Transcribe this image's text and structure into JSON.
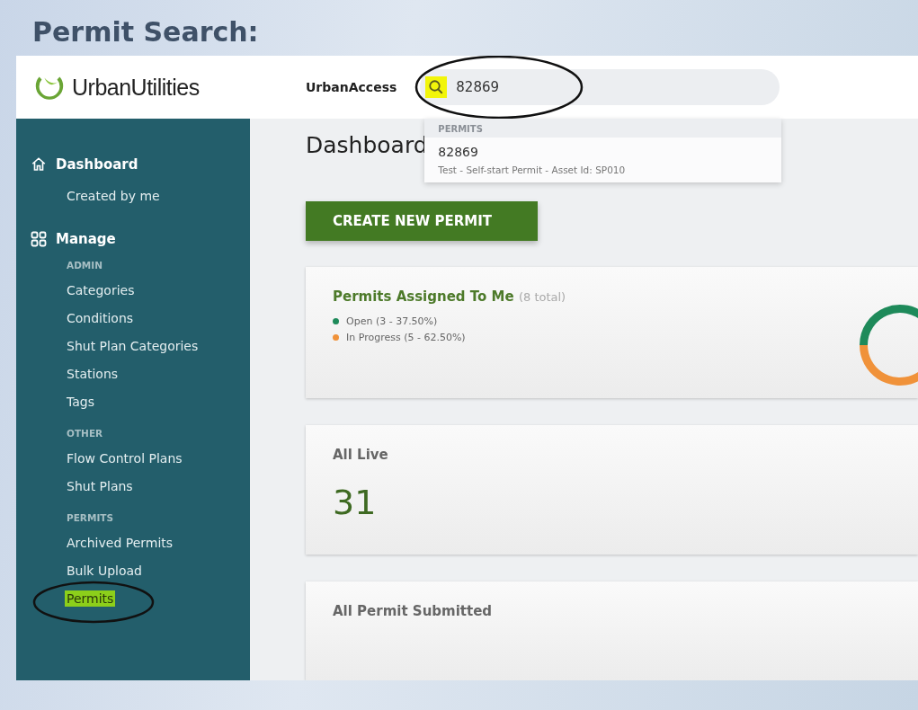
{
  "slide_title": "Permit Search:",
  "header": {
    "logo": "**Urban**Utilities",
    "app_name": "UrbanAccess",
    "search": {
      "value": "82869",
      "icon_highlighted": true,
      "circled": true
    },
    "results": {
      "heading": "PERMITS",
      "items": [
        {
          "title": "82869",
          "detail": "Test - Self-start Permit - Asset Id: SP010"
        }
      ]
    }
  },
  "sidebar": {
    "sections": [
      {
        "label": "Dashboard",
        "groups": [
          {
            "items": [
              {
                "label": "Created by me",
                "selected": false,
                "circled": false
              }
            ]
          }
        ]
      },
      {
        "label": "Manage",
        "groups": [
          {
            "heading": "ADMIN",
            "items": [
              {
                "label": "Categories",
                "selected": false,
                "circled": false
              },
              {
                "label": "Conditions",
                "selected": false,
                "circled": false
              },
              {
                "label": "Shut Plan Categories",
                "selected": false,
                "circled": false
              },
              {
                "label": "Stations",
                "selected": false,
                "circled": false
              },
              {
                "label": "Tags",
                "selected": false,
                "circled": false
              }
            ]
          },
          {
            "heading": "OTHER",
            "items": [
              {
                "label": "Flow Control Plans",
                "selected": false,
                "circled": false
              },
              {
                "label": "Shut Plans",
                "selected": false,
                "circled": false
              }
            ]
          },
          {
            "heading": "PERMITS",
            "items": [
              {
                "label": "Archived Permits",
                "selected": false,
                "circled": false
              },
              {
                "label": "Bulk Upload",
                "selected": false,
                "circled": false
              },
              {
                "label": "Permits",
                "selected": true,
                "circled": true
              }
            ]
          }
        ]
      }
    ]
  },
  "main": {
    "title": "Dashboard",
    "create_button": "CREATE NEW PERMIT",
    "cards": [
      {
        "kind": "chart",
        "title": "Permits Assigned To Me",
        "note": "(8 total)",
        "legend": [
          {
            "color": "#1e8a5a"
          },
          {
            "color": "#f0923a"
          }
        ],
        "chart_data": {
          "type": "donut",
          "categories": [
            "Open (3 - 37.50%)",
            "In Progress (5 - 62.50%)"
          ],
          "values": [
            3,
            5
          ]
        }
      },
      {
        "kind": "number",
        "title": "All Live",
        "value": "31"
      },
      {
        "kind": "title",
        "title": "All Permit Submitted"
      }
    ]
  }
}
